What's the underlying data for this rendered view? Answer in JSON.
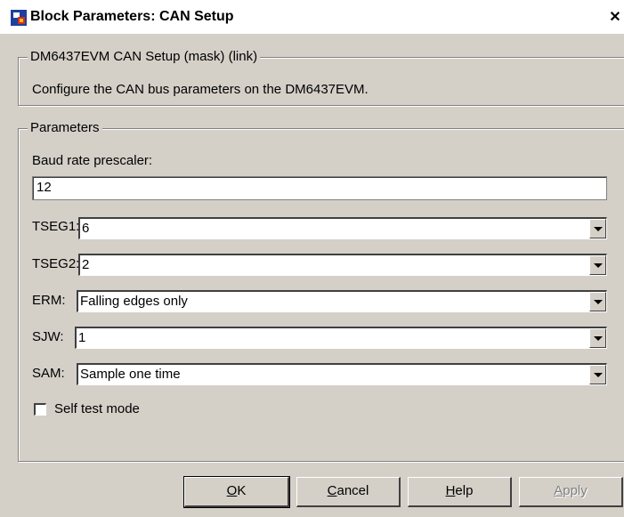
{
  "window": {
    "title": "Block Parameters: CAN Setup",
    "close_glyph": "✕",
    "icon": "simulink-block-icon"
  },
  "mask_group": {
    "legend": "DM6437EVM CAN Setup (mask) (link)",
    "description": "Configure the CAN bus parameters on the DM6437EVM."
  },
  "parameters": {
    "legend": "Parameters",
    "baud_rate": {
      "label": "Baud rate prescaler:",
      "value": "12"
    },
    "tseg1": {
      "label": "TSEG1:",
      "value": "6"
    },
    "tseg2": {
      "label": "TSEG2:",
      "value": "2"
    },
    "erm": {
      "label": "ERM:",
      "value": "Falling edges only"
    },
    "sjw": {
      "label": "SJW:",
      "value": "1"
    },
    "sam": {
      "label": "SAM:",
      "value": "Sample one time"
    },
    "self_test": {
      "label": "Self test mode",
      "checked": false
    }
  },
  "buttons": {
    "ok": {
      "mnemonic": "O",
      "rest": "K"
    },
    "cancel": {
      "mnemonic": "C",
      "rest": "ancel"
    },
    "help": {
      "mnemonic": "H",
      "rest": "elp"
    },
    "apply": {
      "mnemonic": "A",
      "rest": "pply",
      "enabled": false
    }
  }
}
